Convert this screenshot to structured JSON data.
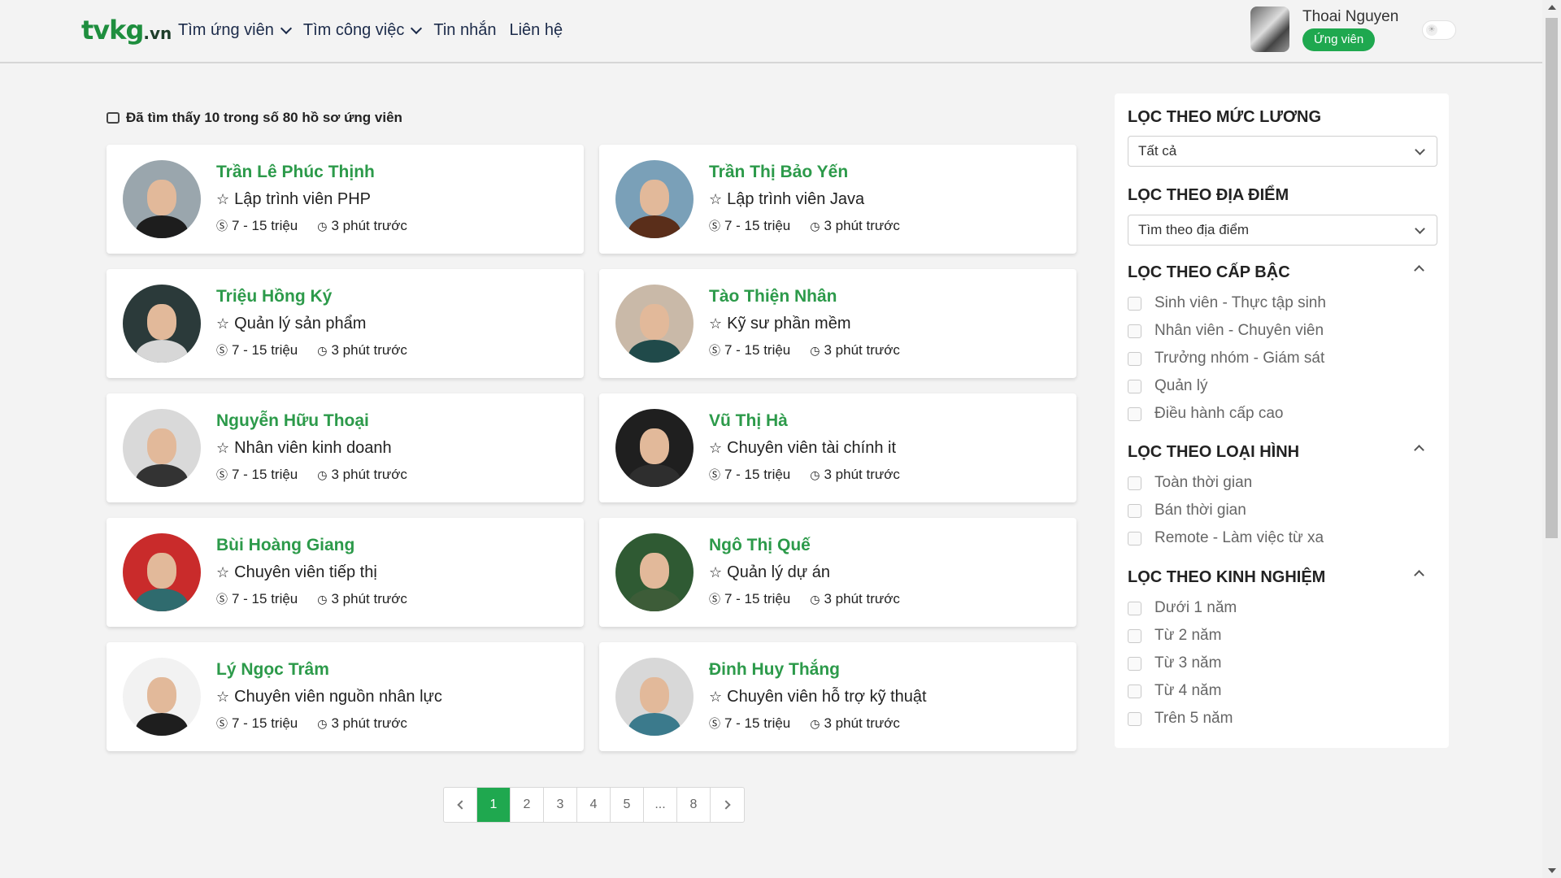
{
  "header": {
    "logo_main": "tvkg",
    "logo_tld": ".vn",
    "nav": [
      {
        "label": "Tìm ứng viên",
        "has_dropdown": true
      },
      {
        "label": "Tìm công việc",
        "has_dropdown": true
      },
      {
        "label": "Tin nhắn",
        "has_dropdown": false
      },
      {
        "label": "Liên hệ",
        "has_dropdown": false
      }
    ],
    "user": {
      "name": "Thoai Nguyen",
      "role": "Ứng viên"
    }
  },
  "results": {
    "count_text": "Đã tìm thấy 10 trong số 80 hồ sơ ứng viên"
  },
  "candidates": [
    {
      "name": "Trần Lê Phúc Thịnh",
      "title": "Lập trình viên PHP",
      "salary": "7 - 15 triệu",
      "time": "3 phút trước"
    },
    {
      "name": "Trần Thị Bảo Yến",
      "title": "Lập trình viên Java",
      "salary": "7 - 15 triệu",
      "time": "3 phút trước"
    },
    {
      "name": "Triệu Hồng Ký",
      "title": "Quản lý sản phẩm",
      "salary": "7 - 15 triệu",
      "time": "3 phút trước"
    },
    {
      "name": "Tào Thiện Nhân",
      "title": "Kỹ sư phần mềm",
      "salary": "7 - 15 triệu",
      "time": "3 phút trước"
    },
    {
      "name": "Nguyễn Hữu Thoại",
      "title": "Nhân viên kinh doanh",
      "salary": "7 - 15 triệu",
      "time": "3 phút trước"
    },
    {
      "name": "Vũ Thị Hà",
      "title": "Chuyên viên tài chính it",
      "salary": "7 - 15 triệu",
      "time": "3 phút trước"
    },
    {
      "name": "Bùi Hoàng Giang",
      "title": "Chuyên viên tiếp thị",
      "salary": "7 - 15 triệu",
      "time": "3 phút trước"
    },
    {
      "name": "Ngô Thị Quế",
      "title": "Quản lý dự án",
      "salary": "7 - 15 triệu",
      "time": "3 phút trước"
    },
    {
      "name": "Lý Ngọc Trâm",
      "title": "Chuyên viên nguồn nhân lực",
      "salary": "7 - 15 triệu",
      "time": "3 phút trước"
    },
    {
      "name": "Đinh Huy Thắng",
      "title": "Chuyên viên hỗ trợ kỹ thuật",
      "salary": "7 - 15 triệu",
      "time": "3 phút trước"
    }
  ],
  "pagination": {
    "pages": [
      "1",
      "2",
      "3",
      "4",
      "5",
      "...",
      "8"
    ],
    "current": "1"
  },
  "filters": {
    "salary": {
      "title": "LỌC THEO MỨC LƯƠNG",
      "selected": "Tất cả"
    },
    "location": {
      "title": "LỌC THEO ĐỊA ĐIỂM",
      "placeholder": "Tìm theo địa điểm"
    },
    "level": {
      "title": "LỌC THEO CẤP BẬC",
      "options": [
        "Sinh viên - Thực tập sinh",
        "Nhân viên - Chuyên viên",
        "Trưởng nhóm - Giám sát",
        "Quản lý",
        "Điều hành cấp cao"
      ]
    },
    "type": {
      "title": "LỌC THEO LOẠI HÌNH",
      "options": [
        "Toàn thời gian",
        "Bán thời gian",
        "Remote - Làm việc từ xa"
      ]
    },
    "experience": {
      "title": "LỌC THEO KINH NGHIỆM",
      "options": [
        "Dưới 1 năm",
        "Từ 2 năm",
        "Từ 3 năm",
        "Từ 4 năm",
        "Trên 5 năm"
      ]
    }
  },
  "colors": {
    "brand_green": "#1fa84f",
    "name_green": "#2c9a4a",
    "page_bg": "#f3f3f3"
  }
}
